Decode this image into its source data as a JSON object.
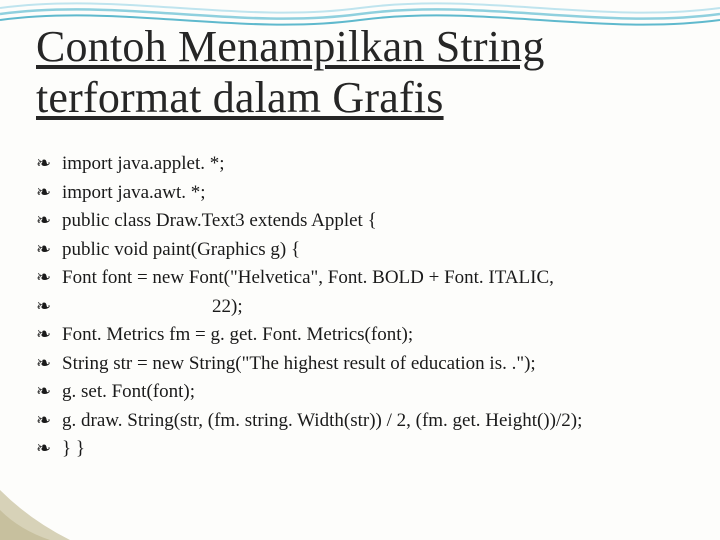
{
  "title": "Contoh Menampilkan String terformat dalam Grafis",
  "bullet_glyph": "❧",
  "lines": [
    "import java.applet. *;",
    "import java.awt. *;",
    "public class Draw.Text3 extends Applet {",
    "public void paint(Graphics g) {",
    "Font font = new Font(\"Helvetica\", Font. BOLD + Font. ITALIC,",
    "",
    "Font. Metrics fm = g. get. Font. Metrics(font);",
    "String str = new String(\"The highest result of education is. .\");",
    "g. set. Font(font);",
    "g. draw. String(str, (fm. string. Width(str)) / 2, (fm. get. Height())/2);",
    "}        }"
  ],
  "continuation_line": "22);",
  "continuation_after_index": 5
}
